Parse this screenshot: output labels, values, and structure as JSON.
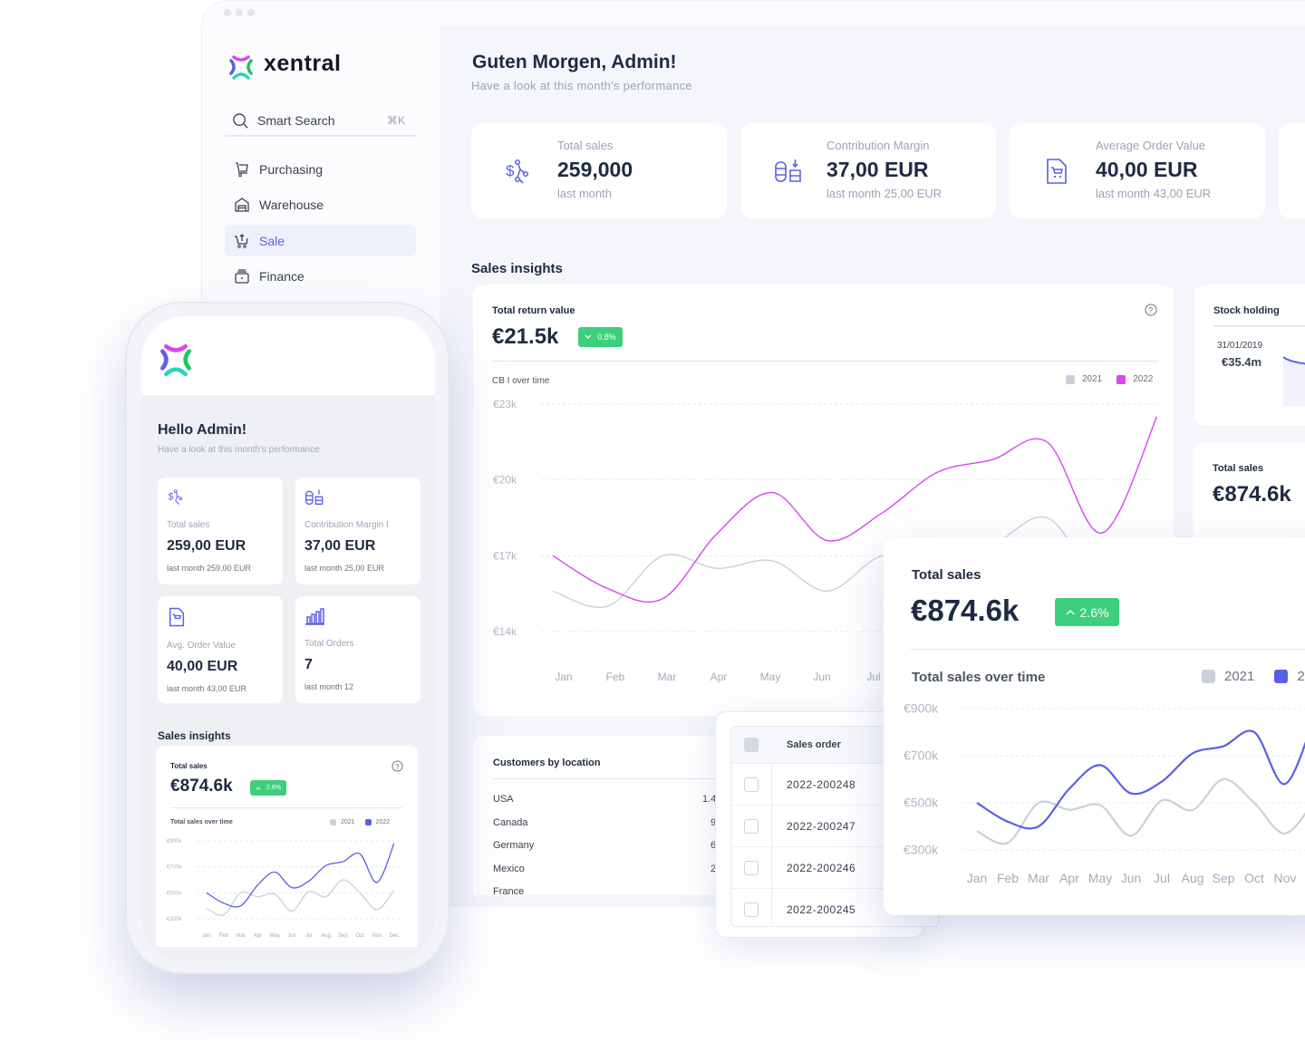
{
  "colors": {
    "accent": "#5b5fe8",
    "magenta": "#d946ef",
    "positive": "#3ecf7e",
    "muted_series": "#cbd0db",
    "text": "#1f2a44"
  },
  "sidebar": {
    "brand": "xentral",
    "search": {
      "label": "Smart Search",
      "shortcut": "⌘K"
    },
    "items": [
      {
        "label": "Purchasing",
        "icon": "cart-trolley-icon"
      },
      {
        "label": "Warehouse",
        "icon": "warehouse-icon"
      },
      {
        "label": "Sale",
        "icon": "cart-upload-icon",
        "active": true
      },
      {
        "label": "Finance",
        "icon": "cash-register-icon"
      }
    ]
  },
  "header": {
    "title": "Guten Morgen, Admin!",
    "subtitle": "Have a look at this month's performance"
  },
  "kpis": [
    {
      "label": "Total sales",
      "value": "259,000",
      "sub": "last month",
      "icon": "dollar-chart-icon"
    },
    {
      "label": "Contribution Margin",
      "value": "37,00 EUR",
      "sub": "last month 25,00 EUR",
      "icon": "coins-icon"
    },
    {
      "label": "Average Order Value",
      "value": "40,00 EUR",
      "sub": "last month 43,00 EUR",
      "icon": "order-document-icon"
    }
  ],
  "insights": {
    "title": "Sales insights",
    "return_card": {
      "title": "Total return value",
      "value": "€21.5k",
      "change": "0.8%",
      "direction": "down"
    },
    "stock": {
      "title": "Stock holding",
      "date": "31/01/2019",
      "value": "€35.4m"
    },
    "small_sales": {
      "title": "Total sales",
      "value": "€874.6k"
    },
    "big_sales": {
      "title": "Total sales",
      "value": "€874.6k",
      "change": "2.6%",
      "direction": "up"
    },
    "customers": {
      "title": "Customers by location",
      "rows": [
        {
          "country": "USA",
          "value": "1.4"
        },
        {
          "country": "Canada",
          "value": "9"
        },
        {
          "country": "Germany",
          "value": "6"
        },
        {
          "country": "Mexico",
          "value": "2"
        },
        {
          "country": "France",
          "value": ""
        }
      ]
    },
    "orders": {
      "header": "Sales order",
      "rows": [
        "2022-200248",
        "2022-200247",
        "2022-200246",
        "2022-200245"
      ]
    }
  },
  "mobile": {
    "greeting": "Hello Admin!",
    "subtitle": "Have a look at this month's performance",
    "cards": [
      {
        "label": "Total sales",
        "value": "259,00 EUR",
        "sub": "last month 259,00 EUR",
        "icon": "dollar-chart-icon"
      },
      {
        "label": "Contribution Margin I",
        "value": "37,00 EUR",
        "sub": "last month 25,00 EUR",
        "icon": "coins-icon"
      },
      {
        "label": "Avg. Order Value",
        "value": "40,00 EUR",
        "sub": "last month 43,00 EUR",
        "icon": "order-document-icon"
      },
      {
        "label": "Total Orders",
        "value": "7",
        "sub": "last month 12",
        "icon": "bar-chart-icon"
      }
    ],
    "insights_title": "Sales insights",
    "sales_card": {
      "title": "Total sales",
      "value": "€874.6k",
      "change": "2.6%",
      "direction": "up"
    }
  },
  "chart_data": [
    {
      "type": "line",
      "title": "CB I over time",
      "categories": [
        "Jan",
        "Feb",
        "Mar",
        "Apr",
        "May",
        "Jun",
        "Jul",
        "Aug",
        "Sep",
        "Oct",
        "Nov",
        "Dec"
      ],
      "x_labels": [
        "Jan",
        "Feb",
        "Mar",
        "Apr",
        "May",
        "Jun",
        "Jul"
      ],
      "y_ticks": [
        "€23k",
        "€20k",
        "€17k",
        "€14k"
      ],
      "ylim": [
        14,
        23
      ],
      "y_tick_values": [
        23,
        20,
        17,
        14
      ],
      "grid": true,
      "legend": "top-right",
      "series": [
        {
          "name": "2021",
          "color": "#cbd0db",
          "values": [
            15.6,
            15.0,
            17.0,
            16.5,
            16.8,
            15.6,
            17.0,
            16.6,
            17.4,
            18.5,
            16.0,
            17.2
          ]
        },
        {
          "name": "2022",
          "color": "#d946ef",
          "values": [
            17.0,
            15.7,
            15.3,
            17.9,
            19.5,
            17.6,
            18.7,
            20.3,
            20.8,
            21.5,
            17.9,
            22.5
          ]
        }
      ]
    },
    {
      "type": "line",
      "title": "Total sales over time",
      "categories": [
        "Jan",
        "Feb",
        "Mar",
        "Apr",
        "May",
        "Jun",
        "Jul",
        "Aug",
        "Sep",
        "Oct",
        "Nov",
        "Dec"
      ],
      "x_labels": [
        "Jan",
        "Feb",
        "Mar",
        "Apr",
        "May",
        "Jun",
        "Jul",
        "Aug",
        "Sep",
        "Oct",
        "Nov"
      ],
      "y_ticks": [
        "€900k",
        "€700k",
        "€500k",
        "€300k"
      ],
      "ylim": [
        300,
        900
      ],
      "y_tick_values": [
        900,
        700,
        500,
        300
      ],
      "grid": true,
      "legend": "top-right",
      "series": [
        {
          "name": "2021",
          "color": "#cbd0db",
          "values": [
            380,
            330,
            500,
            470,
            490,
            360,
            510,
            470,
            600,
            500,
            370,
            520
          ]
        },
        {
          "name": "2022",
          "color": "#5b5fe8",
          "values": [
            500,
            420,
            400,
            560,
            660,
            540,
            590,
            710,
            740,
            800,
            580,
            880
          ]
        }
      ]
    },
    {
      "type": "line",
      "title": "Total sales over time",
      "categories": [
        "Jan",
        "Feb",
        "Mar",
        "Apr",
        "May",
        "Jun",
        "Jul",
        "Aug",
        "Sep",
        "Oct",
        "Nov",
        "Dec"
      ],
      "x_labels": [
        "Jan",
        "Feb",
        "Mar",
        "Apr",
        "May",
        "Jun",
        "Jul",
        "Aug",
        "Sep",
        "Oct",
        "Nov",
        "Dec"
      ],
      "y_ticks": [
        "€900k",
        "€700k",
        "€500k",
        "€300k"
      ],
      "ylim": [
        300,
        900
      ],
      "y_tick_values": [
        900,
        700,
        500,
        300
      ],
      "grid": true,
      "legend": "top-right",
      "series": [
        {
          "name": "2021",
          "color": "#cbd0db",
          "values": [
            380,
            330,
            500,
            470,
            490,
            360,
            510,
            470,
            600,
            500,
            370,
            520
          ]
        },
        {
          "name": "2022",
          "color": "#5b5fe8",
          "values": [
            500,
            420,
            400,
            560,
            660,
            540,
            590,
            710,
            740,
            800,
            580,
            880
          ]
        }
      ]
    }
  ]
}
